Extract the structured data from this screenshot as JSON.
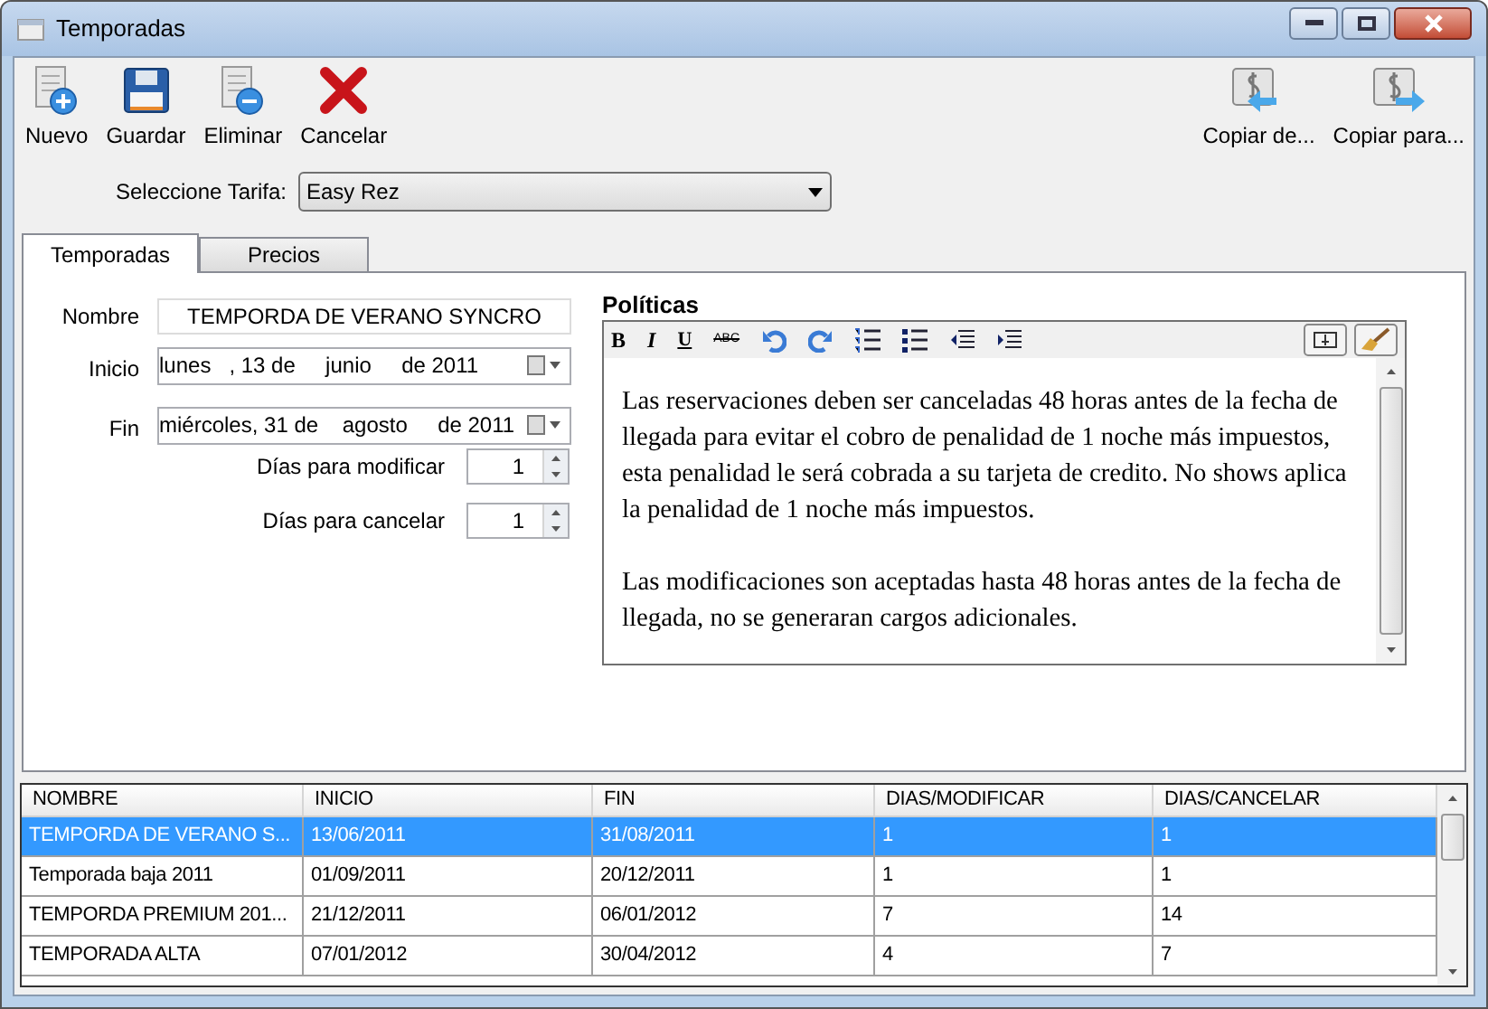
{
  "window": {
    "title": "Temporadas"
  },
  "toolbar": [
    {
      "label": "Nuevo",
      "kind": "new"
    },
    {
      "label": "Guardar",
      "kind": "save"
    },
    {
      "label": "Eliminar",
      "kind": "delete"
    },
    {
      "label": "Cancelar",
      "kind": "cancel"
    }
  ],
  "toolbar_right": [
    {
      "label": "Copiar de...",
      "kind": "copy-from"
    },
    {
      "label": "Copiar para...",
      "kind": "copy-to"
    }
  ],
  "tarifa": {
    "label": "Seleccione Tarifa:",
    "value": "Easy Rez"
  },
  "tabs": [
    {
      "label": "Temporadas",
      "selected": true
    },
    {
      "label": "Precios",
      "selected": false
    }
  ],
  "form": {
    "nombre_label": "Nombre",
    "nombre": "TEMPORDA DE VERANO SYNCRO",
    "inicio_label": "Inicio",
    "inicio": "lunes   , 13 de     junio     de 2011",
    "fin_label": "Fin",
    "fin": "miércoles, 31 de    agosto     de 2011",
    "modificar_label": "Días para modificar",
    "modificar": "1",
    "cancelar_label": "Días para cancelar",
    "cancelar": "1"
  },
  "politicas": {
    "title": "Políticas",
    "format_buttons": [
      "B",
      "I",
      "U",
      "ABC"
    ],
    "paragraphs": [
      "Las reservaciones deben ser canceladas 48 horas antes de la fecha de llegada para evitar el cobro de penalidad de 1 noche más impuestos, esta penalidad le será cobrada a su tarjeta de credito. No shows aplica la penalidad de 1 noche más impuestos.",
      "Las modificaciones son aceptadas hasta 48 horas antes de la fecha de llegada, no se generaran cargos adicionales."
    ]
  },
  "table": {
    "columns": [
      "NOMBRE",
      "INICIO",
      "FIN",
      "DIAS/MODIFICAR",
      "DIAS/CANCELAR"
    ],
    "rows": [
      {
        "cells": [
          "TEMPORDA DE VERANO S...",
          "13/06/2011",
          "31/08/2011",
          "1",
          "1"
        ],
        "selected": true
      },
      {
        "cells": [
          "Temporada baja 2011",
          "01/09/2011",
          "20/12/2011",
          "1",
          "1"
        ],
        "selected": false
      },
      {
        "cells": [
          "TEMPORDA PREMIUM 201...",
          "21/12/2011",
          "06/01/2012",
          "7",
          "14"
        ],
        "selected": false
      },
      {
        "cells": [
          "TEMPORADA ALTA",
          "07/01/2012",
          "30/04/2012",
          "4",
          "7"
        ],
        "selected": false
      }
    ]
  }
}
